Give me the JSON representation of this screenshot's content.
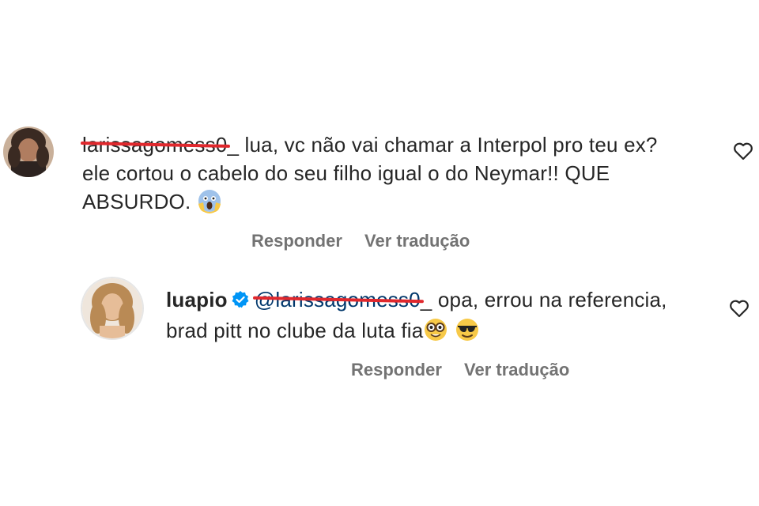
{
  "comments": [
    {
      "username": "larissagomess0",
      "text_lines": [
        "_ lua, vc não vai chamar a Interpol pro teu ex?",
        "ele cortou o cabelo do seu filho igual o do Neymar!! QUE",
        "ABSURDO."
      ],
      "emoji": "😱",
      "reply_label": "Responder",
      "translate_label": "Ver tradução",
      "like_icon": "heart-outline-icon"
    },
    {
      "username": "luapio",
      "verified": true,
      "mention": "@larissagomess0",
      "text_lines": [
        "_ opa, errou na referencia,",
        "brad pitt no clube da luta fia"
      ],
      "emojis": [
        "🤓",
        "😎"
      ],
      "reply_label": "Responder",
      "translate_label": "Ver tradução",
      "like_icon": "heart-outline-icon"
    }
  ],
  "colors": {
    "text": "#262626",
    "secondary": "#737373",
    "redact_line": "#e0282d",
    "verified": "#0095f6"
  }
}
